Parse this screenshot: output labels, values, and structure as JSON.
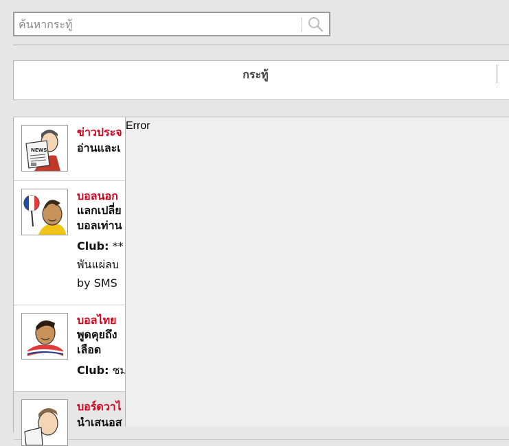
{
  "search": {
    "placeholder": "ค้นหากระทู้",
    "value": ""
  },
  "tabs": [
    {
      "label": "กระทู้"
    }
  ],
  "forums": [
    {
      "title": "ข่าวประจ",
      "desc": [
        "อ่านและเ"
      ],
      "avatar_icon": "news-reader-icon"
    },
    {
      "title": "บอลนอก",
      "desc": [
        "แลกเปลี่ย",
        "บอลเท่าน"
      ],
      "club_label": "Club:",
      "club_value": "**",
      "extra": [
        "พันแผ่ลบ",
        "by SMS"
      ],
      "avatar_icon": "french-fan-icon"
    },
    {
      "title": "บอลไทย",
      "desc": [
        "พูดคุยถึง",
        "เลือด"
      ],
      "club_label": "Club:",
      "club_value": "ชม",
      "avatar_icon": "thai-fan-icon"
    },
    {
      "title": "บอร์ดวาไ",
      "desc": [
        "นำเสนอส"
      ],
      "avatar_icon": "man-reading-icon"
    }
  ],
  "error": {
    "message": "Error"
  },
  "colors": {
    "title_red": "#d0021b",
    "background": "#e6e6e6"
  }
}
